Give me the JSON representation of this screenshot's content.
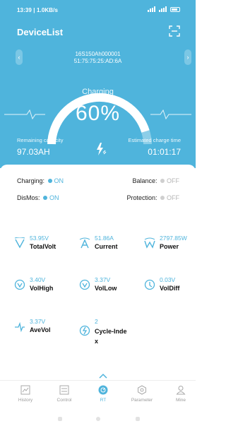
{
  "status_bar": {
    "time": "13:39 | 1.0KB/s"
  },
  "header": {
    "title": "DeviceList"
  },
  "device": {
    "name": "16S150Ah000001",
    "mac": "51:75:75:25:AD:6A"
  },
  "gauge": {
    "status": "Charging",
    "percent_text": "60%",
    "percent": 0.6
  },
  "remaining": {
    "label": "Remaining capacity",
    "value": "97.03AH"
  },
  "estimated": {
    "label": "Estimated charge time",
    "value": "01:01:17"
  },
  "switches": {
    "charging": {
      "label": "Charging:",
      "state": "ON"
    },
    "balance": {
      "label": "Balance:",
      "state": "OFF"
    },
    "dismos": {
      "label": "DisMos:",
      "state": "ON"
    },
    "protection": {
      "label": "Protection:",
      "state": "OFF"
    }
  },
  "metrics": [
    {
      "value": "53.95V",
      "label": "TotalVolt",
      "icon": "voltage-icon"
    },
    {
      "value": "51.86A",
      "label": "Current",
      "icon": "current-icon"
    },
    {
      "value": "2797.85W",
      "label": "Power",
      "icon": "power-icon"
    },
    {
      "value": "3.40V",
      "label": "VolHigh",
      "icon": "vol-high-icon"
    },
    {
      "value": "3.37V",
      "label": "VolLow",
      "icon": "vol-low-icon"
    },
    {
      "value": "0.03V",
      "label": "VolDiff",
      "icon": "vol-diff-icon"
    },
    {
      "value": "3.37V",
      "label": "AveVol",
      "icon": "ave-vol-icon"
    },
    {
      "value": "2",
      "label": "Cycle-Index",
      "icon": "cycle-icon"
    }
  ],
  "tabs": [
    {
      "label": "History",
      "icon": "chart-icon"
    },
    {
      "label": "Control",
      "icon": "control-icon"
    },
    {
      "label": "RT",
      "icon": "realtime-icon",
      "active": true
    },
    {
      "label": "Parameter",
      "icon": "parameter-icon"
    },
    {
      "label": "Mine",
      "icon": "user-icon"
    }
  ],
  "colors": {
    "accent": "#4fb4dc",
    "off": "#b5b5b5"
  }
}
